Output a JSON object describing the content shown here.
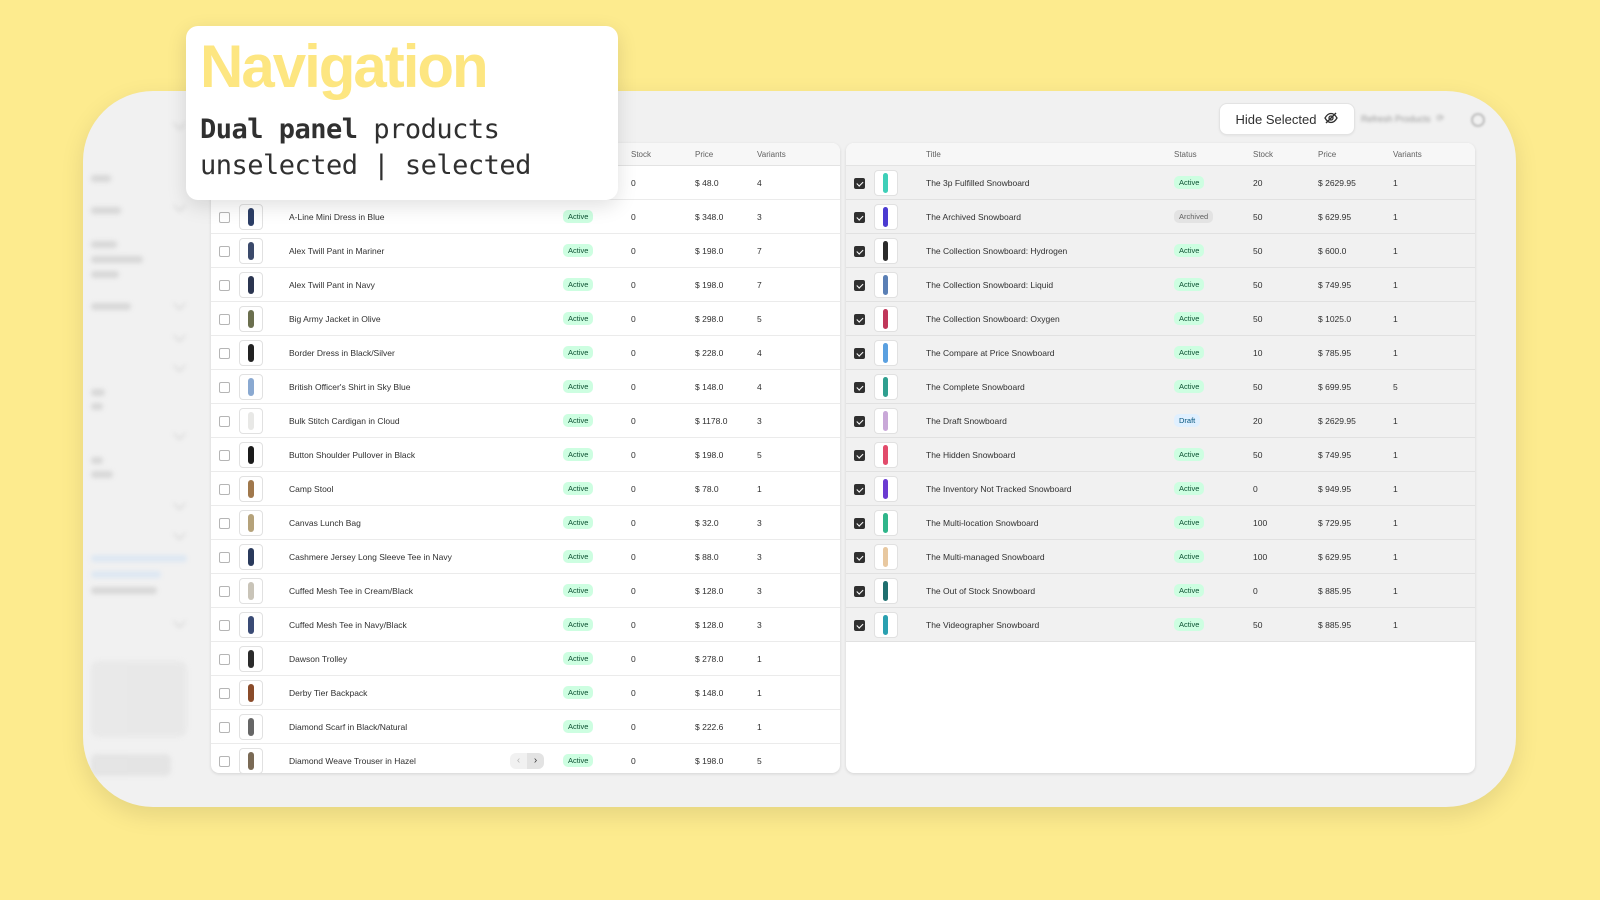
{
  "callout": {
    "title": "Navigation",
    "line1_bold": "Dual panel",
    "line1_rest": " products",
    "line2": "unselected | selected"
  },
  "toolbar": {
    "hide_selected_label": "Hide Selected",
    "hide_icon": "eye-slash-icon",
    "refresh_label": "Refresh Products",
    "gear_icon": "gear-icon"
  },
  "left_panel": {
    "columns": {
      "stock": "Stock",
      "price": "Price",
      "variants": "Variants"
    },
    "first_row_partial": {
      "stock": "0",
      "price": "$ 48.0",
      "variants": "4"
    },
    "rows": [
      {
        "title": "A-Line Mini Dress in Blue",
        "status": "Active",
        "stock": "0",
        "price": "$ 348.0",
        "variants": "3"
      },
      {
        "title": "Alex Twill Pant in Mariner",
        "status": "Active",
        "stock": "0",
        "price": "$ 198.0",
        "variants": "7"
      },
      {
        "title": "Alex Twill Pant in Navy",
        "status": "Active",
        "stock": "0",
        "price": "$ 198.0",
        "variants": "7"
      },
      {
        "title": "Big Army Jacket in Olive",
        "status": "Active",
        "stock": "0",
        "price": "$ 298.0",
        "variants": "5"
      },
      {
        "title": "Border Dress in Black/Silver",
        "status": "Active",
        "stock": "0",
        "price": "$ 228.0",
        "variants": "4"
      },
      {
        "title": "British Officer's Shirt in Sky Blue",
        "status": "Active",
        "stock": "0",
        "price": "$ 148.0",
        "variants": "4"
      },
      {
        "title": "Bulk Stitch Cardigan in Cloud",
        "status": "Active",
        "stock": "0",
        "price": "$ 1178.0",
        "variants": "3"
      },
      {
        "title": "Button Shoulder Pullover in Black",
        "status": "Active",
        "stock": "0",
        "price": "$ 198.0",
        "variants": "5"
      },
      {
        "title": "Camp Stool",
        "status": "Active",
        "stock": "0",
        "price": "$ 78.0",
        "variants": "1"
      },
      {
        "title": "Canvas Lunch Bag",
        "status": "Active",
        "stock": "0",
        "price": "$ 32.0",
        "variants": "3"
      },
      {
        "title": "Cashmere Jersey Long Sleeve Tee in Navy",
        "status": "Active",
        "stock": "0",
        "price": "$ 88.0",
        "variants": "3"
      },
      {
        "title": "Cuffed Mesh Tee in Cream/Black",
        "status": "Active",
        "stock": "0",
        "price": "$ 128.0",
        "variants": "3"
      },
      {
        "title": "Cuffed Mesh Tee in Navy/Black",
        "status": "Active",
        "stock": "0",
        "price": "$ 128.0",
        "variants": "3"
      },
      {
        "title": "Dawson Trolley",
        "status": "Active",
        "stock": "0",
        "price": "$ 278.0",
        "variants": "1"
      },
      {
        "title": "Derby Tier Backpack",
        "status": "Active",
        "stock": "0",
        "price": "$ 148.0",
        "variants": "1"
      },
      {
        "title": "Diamond Scarf in Black/Natural",
        "status": "Active",
        "stock": "0",
        "price": "$ 222.6",
        "variants": "1"
      },
      {
        "title": "Diamond Weave Trouser in Hazel",
        "status": "Active",
        "stock": "0",
        "price": "$ 198.0",
        "variants": "5"
      }
    ],
    "pager": {
      "prev": "‹",
      "next": "›"
    }
  },
  "right_panel": {
    "columns": {
      "title": "Title",
      "status": "Status",
      "stock": "Stock",
      "price": "Price",
      "variants": "Variants"
    },
    "rows": [
      {
        "title": "The 3p Fulfilled Snowboard",
        "status": "Active",
        "stock": "20",
        "price": "$ 2629.95",
        "variants": "1"
      },
      {
        "title": "The Archived Snowboard",
        "status": "Archived",
        "stock": "50",
        "price": "$ 629.95",
        "variants": "1"
      },
      {
        "title": "The Collection Snowboard: Hydrogen",
        "status": "Active",
        "stock": "50",
        "price": "$ 600.0",
        "variants": "1"
      },
      {
        "title": "The Collection Snowboard: Liquid",
        "status": "Active",
        "stock": "50",
        "price": "$ 749.95",
        "variants": "1"
      },
      {
        "title": "The Collection Snowboard: Oxygen",
        "status": "Active",
        "stock": "50",
        "price": "$ 1025.0",
        "variants": "1"
      },
      {
        "title": "The Compare at Price Snowboard",
        "status": "Active",
        "stock": "10",
        "price": "$ 785.95",
        "variants": "1"
      },
      {
        "title": "The Complete Snowboard",
        "status": "Active",
        "stock": "50",
        "price": "$ 699.95",
        "variants": "5"
      },
      {
        "title": "The Draft Snowboard",
        "status": "Draft",
        "stock": "20",
        "price": "$ 2629.95",
        "variants": "1"
      },
      {
        "title": "The Hidden Snowboard",
        "status": "Active",
        "stock": "50",
        "price": "$ 749.95",
        "variants": "1"
      },
      {
        "title": "The Inventory Not Tracked Snowboard",
        "status": "Active",
        "stock": "0",
        "price": "$ 949.95",
        "variants": "1"
      },
      {
        "title": "The Multi-location Snowboard",
        "status": "Active",
        "stock": "100",
        "price": "$ 729.95",
        "variants": "1"
      },
      {
        "title": "The Multi-managed Snowboard",
        "status": "Active",
        "stock": "100",
        "price": "$ 629.95",
        "variants": "1"
      },
      {
        "title": "The Out of Stock Snowboard",
        "status": "Active",
        "stock": "0",
        "price": "$ 885.95",
        "variants": "1"
      },
      {
        "title": "The Videographer Snowboard",
        "status": "Active",
        "stock": "50",
        "price": "$ 885.95",
        "variants": "1"
      }
    ]
  },
  "colors": {
    "background": "#fdeb8e",
    "callout_title": "#fde681",
    "active_badge": "#cdfee1",
    "archived_badge": "#e3e3e3",
    "draft_badge": "#e0f0ff"
  }
}
